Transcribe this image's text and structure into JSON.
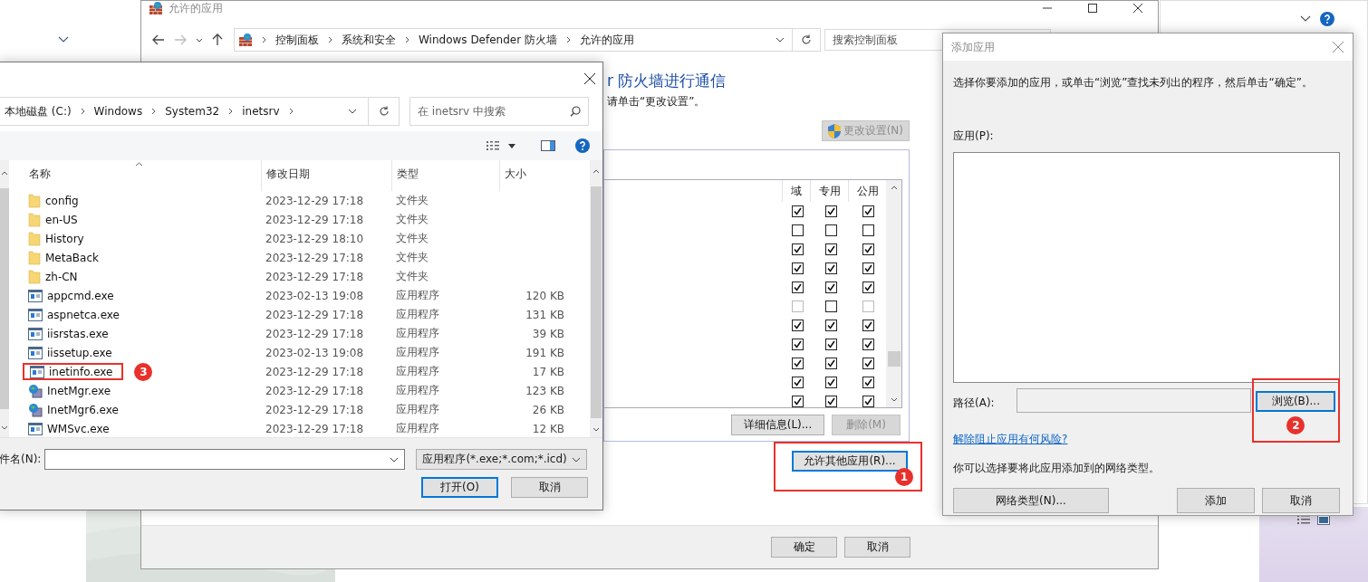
{
  "main_window": {
    "title": "允许的应用",
    "breadcrumb": [
      "控制面板",
      "系统和安全",
      "Windows Defender 防火墙",
      "允许的应用"
    ],
    "search": {
      "placeholder": "搜索控制面板"
    },
    "heading": "r 防火墙进行通信",
    "instruction": "请单击“更改设置”。",
    "change_settings_button": {
      "label": "更改设置(N)",
      "disabled": true
    },
    "columns": [
      "域",
      "专用",
      "公用"
    ],
    "rows": [
      {
        "checks": [
          {
            "checked": true,
            "disabled": false
          },
          {
            "checked": true,
            "disabled": false
          },
          {
            "checked": true,
            "disabled": false
          }
        ]
      },
      {
        "checks": [
          {
            "checked": false,
            "disabled": false
          },
          {
            "checked": false,
            "disabled": false
          },
          {
            "checked": false,
            "disabled": false
          }
        ]
      },
      {
        "checks": [
          {
            "checked": true,
            "disabled": false
          },
          {
            "checked": true,
            "disabled": false
          },
          {
            "checked": true,
            "disabled": false
          }
        ]
      },
      {
        "checks": [
          {
            "checked": true,
            "disabled": false
          },
          {
            "checked": true,
            "disabled": false
          },
          {
            "checked": true,
            "disabled": false
          }
        ]
      },
      {
        "checks": [
          {
            "checked": true,
            "disabled": false
          },
          {
            "checked": true,
            "disabled": false
          },
          {
            "checked": true,
            "disabled": false
          }
        ]
      },
      {
        "checks": [
          {
            "checked": false,
            "disabled": true
          },
          {
            "checked": false,
            "disabled": false
          },
          {
            "checked": false,
            "disabled": true
          }
        ]
      },
      {
        "checks": [
          {
            "checked": true,
            "disabled": false
          },
          {
            "checked": true,
            "disabled": false
          },
          {
            "checked": true,
            "disabled": false
          }
        ]
      },
      {
        "checks": [
          {
            "checked": true,
            "disabled": false
          },
          {
            "checked": true,
            "disabled": false
          },
          {
            "checked": true,
            "disabled": false
          }
        ]
      },
      {
        "checks": [
          {
            "checked": true,
            "disabled": false
          },
          {
            "checked": true,
            "disabled": false
          },
          {
            "checked": true,
            "disabled": false
          }
        ]
      },
      {
        "checks": [
          {
            "checked": true,
            "disabled": false
          },
          {
            "checked": true,
            "disabled": false
          },
          {
            "checked": true,
            "disabled": false
          }
        ]
      },
      {
        "checks": [
          {
            "checked": true,
            "disabled": false
          },
          {
            "checked": true,
            "disabled": false
          },
          {
            "checked": true,
            "disabled": false
          }
        ]
      }
    ],
    "details_button": {
      "label": "详细信息(L)...",
      "disabled": false
    },
    "remove_button": {
      "label": "删除(M)",
      "disabled": true
    },
    "allow_other_button": {
      "label": "允许其他应用(R)...",
      "annotation": "1"
    },
    "ok_button": "确定",
    "cancel_button": "取消"
  },
  "file_dialog": {
    "path": [
      "本地磁盘 (C:)",
      "Windows",
      "System32",
      "inetsrv"
    ],
    "search": {
      "placeholder": "在 inetsrv 中搜索"
    },
    "columns": [
      "名称",
      "修改日期",
      "类型",
      "大小"
    ],
    "files": [
      {
        "name": "config",
        "date": "2023-12-29 17:18",
        "type": "文件夹",
        "kind": "folder"
      },
      {
        "name": "en-US",
        "date": "2023-12-29 17:18",
        "type": "文件夹",
        "kind": "folder"
      },
      {
        "name": "History",
        "date": "2023-12-29 18:10",
        "type": "文件夹",
        "kind": "folder"
      },
      {
        "name": "MetaBack",
        "date": "2023-12-29 17:18",
        "type": "文件夹",
        "kind": "folder"
      },
      {
        "name": "zh-CN",
        "date": "2023-12-29 17:18",
        "type": "文件夹",
        "kind": "folder"
      },
      {
        "name": "appcmd.exe",
        "date": "2023-02-13 19:08",
        "type": "应用程序",
        "size": "120 KB",
        "kind": "app"
      },
      {
        "name": "aspnetca.exe",
        "date": "2023-12-29 17:18",
        "type": "应用程序",
        "size": "131 KB",
        "kind": "app"
      },
      {
        "name": "iisrstas.exe",
        "date": "2023-12-29 17:18",
        "type": "应用程序",
        "size": "39 KB",
        "kind": "app"
      },
      {
        "name": "iissetup.exe",
        "date": "2023-02-13 19:08",
        "type": "应用程序",
        "size": "191 KB",
        "kind": "app"
      },
      {
        "name": "inetinfo.exe",
        "date": "2023-12-29 17:18",
        "type": "应用程序",
        "size": "17 KB",
        "kind": "app",
        "annotation": "3"
      },
      {
        "name": "InetMgr.exe",
        "date": "2023-12-29 17:18",
        "type": "应用程序",
        "size": "123 KB",
        "kind": "manager"
      },
      {
        "name": "InetMgr6.exe",
        "date": "2023-12-29 17:18",
        "type": "应用程序",
        "size": "26 KB",
        "kind": "manager"
      },
      {
        "name": "WMSvc.exe",
        "date": "2023-12-29 17:18",
        "type": "应用程序",
        "size": "12 KB",
        "kind": "app"
      }
    ],
    "filename_label": "件名(N):",
    "filter": "应用程序(*.exe;*.com;*.icd)",
    "open_button": "打开(O)",
    "cancel_button": "取消"
  },
  "add_app_dialog": {
    "title": "添加应用",
    "instruction": "选择你要添加的应用，或单击“浏览”查找未列出的程序，然后单击“确定”。",
    "apps_label": "应用(P):",
    "path_label": "路径(A):",
    "browse_button": {
      "label": "浏览(B)...",
      "annotation": "2"
    },
    "risk_link": "解除阻止应用有何风险?",
    "network_note": "你可以选择要将此应用添加到的网络类型。",
    "network_types_button": "网络类型(N)...",
    "add_button": "添加",
    "cancel_button": "取消"
  }
}
